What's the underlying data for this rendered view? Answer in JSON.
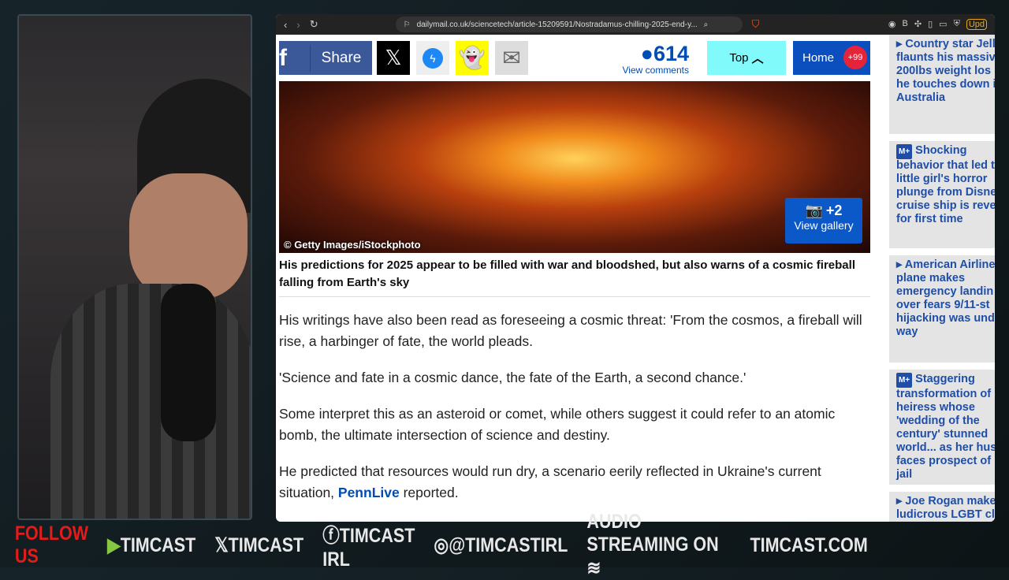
{
  "browser": {
    "url": "dailymail.co.uk/sciencetech/article-15209591/Nostradamus-chilling-2025-end-y...",
    "update_label": "Upd"
  },
  "sharebar": {
    "share_label": "Share",
    "comment_count": "614",
    "view_comments": "View comments",
    "top_label": "Top",
    "home_label": "Home",
    "home_badge": "+99"
  },
  "image": {
    "credit": "© Getty Images/iStockphoto",
    "gallery_count": "+2",
    "gallery_label": "View gallery"
  },
  "article": {
    "caption": "His predictions for 2025 appear to be filled with war and bloodshed, but also warns of a cosmic fireball falling from Earth's sky",
    "paragraphs": [
      "His writings have also been read as foreseeing a cosmic threat: 'From the cosmos, a fireball will rise, a harbinger of fate, the world pleads.",
      "'Science and fate in a cosmic dance, the fate of the Earth, a second chance.'",
      "Some interpret this as an asteroid or comet, while others suggest it could refer to an atomic bomb, the ultimate intersection of science and destiny."
    ],
    "p4_before": "He predicted that resources would run dry, a scenario eerily reflected in Ukraine's current situation, ",
    "p4_link": "PennLive",
    "p4_after": " reported."
  },
  "sidebar": [
    {
      "badge": "",
      "lines": [
        "Country star Jell",
        "flaunts his massiv",
        "200lbs weight los",
        "he touches down i",
        "Australia"
      ]
    },
    {
      "badge": "M+",
      "lines": [
        "Shocking",
        "behavior that led t",
        "little girl's horror",
        "plunge from Disne",
        "cruise ship is reve",
        "for first time"
      ]
    },
    {
      "badge": "",
      "lines": [
        "American Airline",
        "plane makes",
        "emergency landin",
        "over fears 9/11-st",
        "hijacking was und",
        "way"
      ]
    },
    {
      "badge": "M+",
      "lines": [
        "Staggering",
        "transformation of",
        "heiress whose",
        "'wedding of the",
        "century' stunned",
        "world... as her hus",
        "faces prospect of",
        "jail"
      ]
    },
    {
      "badge": "",
      "lines": [
        "Joe Rogan make",
        "ludicrous LGBT cl"
      ]
    }
  ],
  "footer": {
    "follow": "FOLLOW US",
    "rumble": "TIMCAST",
    "x": "𝕏TIMCAST",
    "fb": "TIMCAST IRL",
    "ig": "@TIMCASTIRL",
    "audio": "AUDIO STREAMING ON",
    "site": "TIMCAST.COM"
  }
}
